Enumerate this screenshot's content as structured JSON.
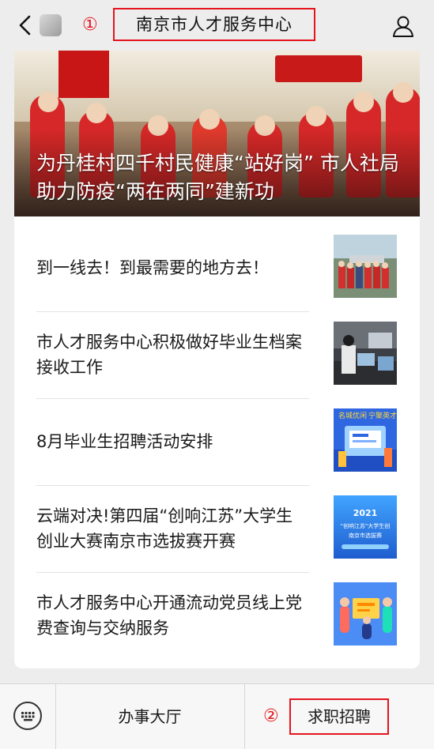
{
  "header": {
    "title": "南京市人才服务中心",
    "marker_1": "①"
  },
  "hero": {
    "title": "为丹桂村四千村民健康“站好岗” 市人社局助力防疫“两在两同”建新功"
  },
  "articles": [
    {
      "title": "到一线去！到最需要的地方去！"
    },
    {
      "title": "市人才服务中心积极做好毕业生档案接收工作"
    },
    {
      "title": "8月毕业生招聘活动安排"
    },
    {
      "title": "云端对决!第四届“创响江苏”大学生创业大赛南京市选拔赛开赛"
    },
    {
      "title": "市人才服务中心开通流动党员线上党费查询与交纳服务"
    }
  ],
  "thumb_text": {
    "t3_line1": "名城优闲",
    "t3_line2": "宁聚英才",
    "t4_year": "2021",
    "t4_line1": "\"创响江苏\"大学生创",
    "t4_line2": "南京市选拔赛"
  },
  "tabbar": {
    "tab1_label": "办事大厅",
    "tab2_label": "求职招聘",
    "marker_2": "②"
  },
  "colors": {
    "accent_red": "#e5141d",
    "background": "#ededed",
    "card": "#ffffff"
  },
  "icons": [
    "back-arrow-icon",
    "profile-icon",
    "keyboard-icon"
  ]
}
